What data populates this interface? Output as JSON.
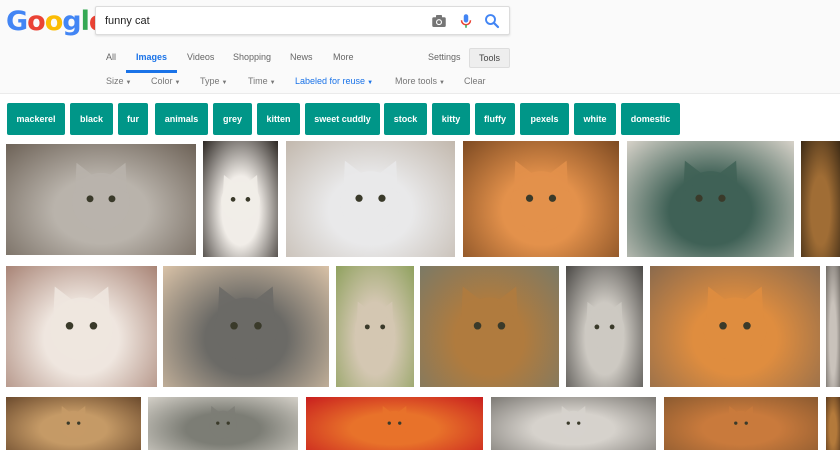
{
  "logo": {
    "letters": [
      "G",
      "o",
      "o",
      "g",
      "l",
      "e"
    ],
    "colors": [
      "#4285f4",
      "#ea4335",
      "#fbbc05",
      "#4285f4",
      "#34a853",
      "#ea4335"
    ]
  },
  "search": {
    "value": "funny cat",
    "camera_icon": "camera-icon",
    "mic_icon": "mic-icon",
    "search_icon": "search-icon"
  },
  "tabs": [
    {
      "label": "All"
    },
    {
      "label": "Images",
      "active": true
    },
    {
      "label": "Videos"
    },
    {
      "label": "Shopping"
    },
    {
      "label": "News"
    },
    {
      "label": "More"
    }
  ],
  "settings": "Settings",
  "tools": "Tools",
  "filters": [
    {
      "label": "Size"
    },
    {
      "label": "Color"
    },
    {
      "label": "Type"
    },
    {
      "label": "Time"
    },
    {
      "label": "Labeled for reuse",
      "active": true
    },
    {
      "label": "More tools"
    },
    {
      "label": "Clear"
    }
  ],
  "chips": [
    "mackerel",
    "black",
    "fur",
    "animals",
    "grey",
    "kitten",
    "sweet cuddly",
    "stock",
    "kitty",
    "fluffy",
    "pexels",
    "white",
    "domestic"
  ],
  "colors": {
    "accent": "#1a73e8",
    "chip_bg": "#009688"
  },
  "images": [
    {
      "name": "cat-image-1",
      "c1": "#b9b3ab",
      "c2": "#6d6257"
    },
    {
      "name": "cat-image-2",
      "c1": "#f1ede8",
      "c2": "#2b2622"
    },
    {
      "name": "cat-image-3",
      "c1": "#e9e9ea",
      "c2": "#c2b8ad"
    },
    {
      "name": "cat-image-4",
      "c1": "#e3914b",
      "c2": "#7d4a22"
    },
    {
      "name": "cat-image-5",
      "c1": "#3f6156",
      "c2": "#d7d2c9"
    },
    {
      "name": "cat-image-6",
      "c1": "#a06d35",
      "c2": "#3c2a15"
    },
    {
      "name": "cat-image-7",
      "c1": "#efe6df",
      "c2": "#a88476"
    },
    {
      "name": "cat-image-8",
      "c1": "#6b6a66",
      "c2": "#d9c2a7"
    },
    {
      "name": "cat-image-9",
      "c1": "#d4c7b2",
      "c2": "#8fa15e"
    },
    {
      "name": "cat-image-10",
      "c1": "#b07b3e",
      "c2": "#7b7a66"
    },
    {
      "name": "cat-image-11",
      "c1": "#cdc9c2",
      "c2": "#4a4845"
    },
    {
      "name": "cat-image-12",
      "c1": "#df8d3f",
      "c2": "#8a6a4d"
    },
    {
      "name": "cat-image-13",
      "c1": "#c9c2bb",
      "c2": "#6f6a64"
    },
    {
      "name": "cat-image-14",
      "c1": "#c59a66",
      "c2": "#6b4a2d"
    },
    {
      "name": "cat-image-15",
      "c1": "#7c7d75",
      "c2": "#d4d0c8"
    },
    {
      "name": "cat-image-16",
      "c1": "#e8722a",
      "c2": "#c81e1e"
    },
    {
      "name": "cat-image-17",
      "c1": "#d6d2cc",
      "c2": "#7d7a75"
    },
    {
      "name": "cat-image-18",
      "c1": "#c97a3c",
      "c2": "#8b5a30"
    },
    {
      "name": "cat-image-19",
      "c1": "#b47a3b",
      "c2": "#5d3c1f"
    }
  ]
}
